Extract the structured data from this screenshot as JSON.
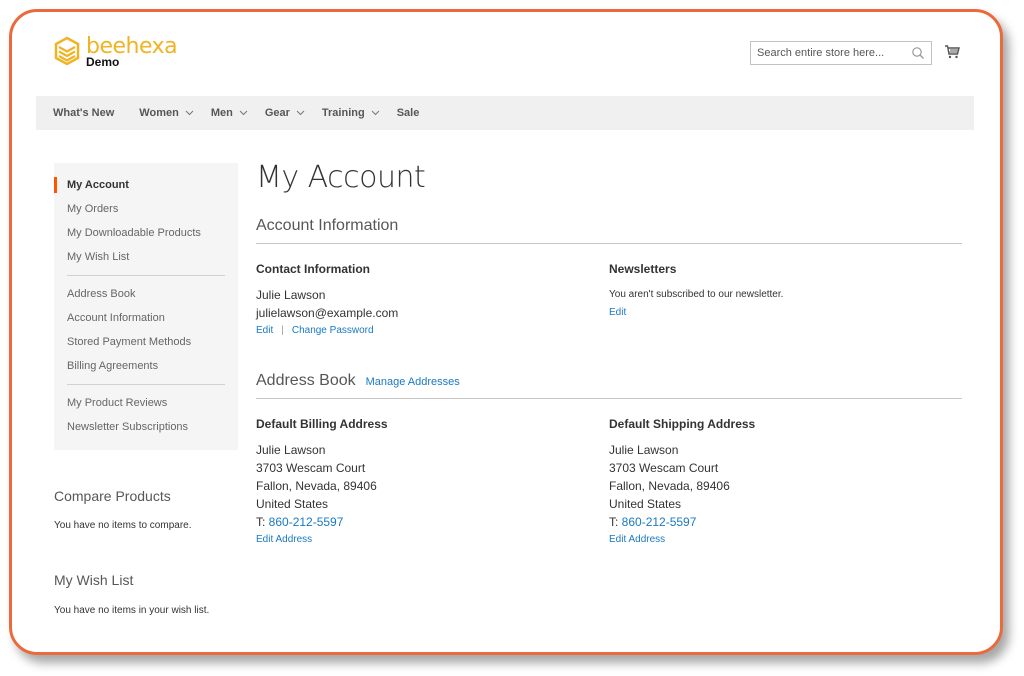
{
  "brand": {
    "name": "beehexa",
    "sub": "Demo",
    "accent": "#f0b323",
    "frame_color": "#eb6a3c"
  },
  "header": {
    "search_placeholder": "Search entire store here...",
    "search_icon": "search-icon",
    "cart_icon": "cart-icon"
  },
  "nav": {
    "items": [
      {
        "label": "What's New",
        "dropdown": false
      },
      {
        "label": "Women",
        "dropdown": true
      },
      {
        "label": "Men",
        "dropdown": true
      },
      {
        "label": "Gear",
        "dropdown": true
      },
      {
        "label": "Training",
        "dropdown": true
      },
      {
        "label": "Sale",
        "dropdown": false
      }
    ]
  },
  "sidebar": {
    "groups": [
      [
        "My Account",
        "My Orders",
        "My Downloadable Products",
        "My Wish List"
      ],
      [
        "Address Book",
        "Account Information",
        "Stored Payment Methods",
        "Billing Agreements"
      ],
      [
        "My Product Reviews",
        "Newsletter Subscriptions"
      ]
    ],
    "active": "My Account",
    "compare": {
      "title": "Compare Products",
      "text": "You have no items to compare."
    },
    "wishlist": {
      "title": "My Wish List",
      "text": "You have no items in your wish list."
    }
  },
  "main": {
    "title": "My Account",
    "account_info": {
      "title": "Account Information",
      "contact": {
        "title": "Contact Information",
        "name": "Julie Lawson",
        "email": "julielawson@example.com",
        "edit": "Edit",
        "separator": "|",
        "change_password": "Change Password"
      },
      "newsletters": {
        "title": "Newsletters",
        "text": "You aren't subscribed to our newsletter.",
        "edit": "Edit"
      }
    },
    "address_book": {
      "title": "Address Book",
      "manage": "Manage Addresses",
      "billing": {
        "title": "Default Billing Address",
        "name": "Julie Lawson",
        "street": "3703 Wescam Court",
        "city": "Fallon, Nevada, 89406",
        "country": "United States",
        "phone_prefix": "T: ",
        "phone": "860-212-5597",
        "edit": "Edit Address"
      },
      "shipping": {
        "title": "Default Shipping Address",
        "name": "Julie Lawson",
        "street": "3703 Wescam Court",
        "city": "Fallon, Nevada, 89406",
        "country": "United States",
        "phone_prefix": "T: ",
        "phone": "860-212-5597",
        "edit": "Edit Address"
      }
    }
  }
}
